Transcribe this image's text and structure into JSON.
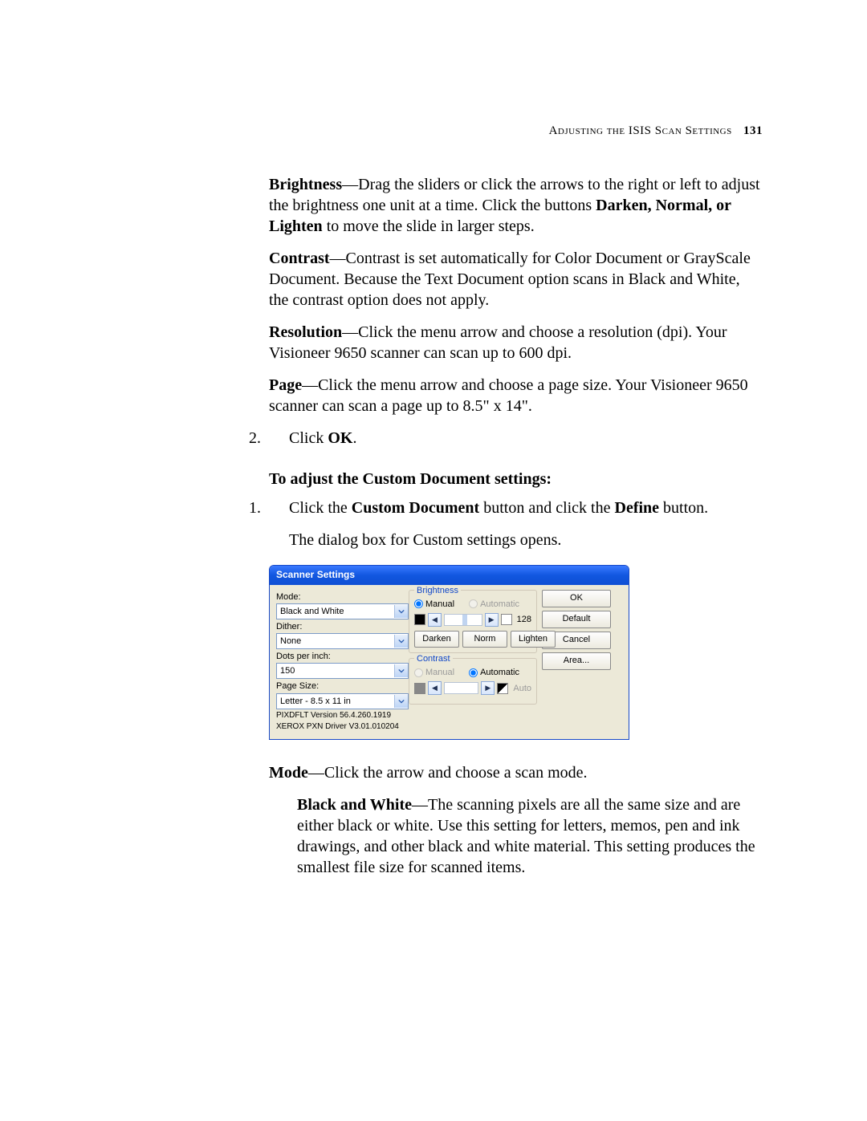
{
  "header": {
    "section": "Adjusting the ISIS Scan Settings",
    "pageno": "131"
  },
  "p_brightness": {
    "label": "Brightness",
    "text": "—Drag the sliders or click the arrows to the right or left to adjust the brightness one unit at a time. Click the buttons ",
    "bold_list": "Darken, Normal, or Lighten",
    "tail": " to move the slide in larger steps."
  },
  "p_contrast": {
    "label": "Contrast",
    "text": "—Contrast is set automatically for Color Document or GrayScale Document. Because the Text Document option scans in Black and White, the contrast option does not apply."
  },
  "p_resolution": {
    "label": "Resolution",
    "text": "—Click the menu arrow and choose a resolution (dpi). Your Visioneer 9650 scanner can scan up to 600 dpi."
  },
  "p_page": {
    "label": "Page",
    "text": "—Click the menu arrow and choose a page size. Your Visioneer 9650 scanner can scan a page up to 8.5\" x 14\"."
  },
  "step2": {
    "num": "2.",
    "pre": "Click ",
    "bold": "OK",
    "post": "."
  },
  "heading2": "To adjust the Custom Document settings:",
  "step_cd": {
    "num": "1.",
    "pre": "Click the ",
    "b1": "Custom Document",
    "mid": " button and click the ",
    "b2": "Define",
    "post": " button."
  },
  "step_cd_line2": "The dialog box for Custom settings opens.",
  "dialog": {
    "title": "Scanner Settings",
    "mode": {
      "label": "Mode:",
      "value": "Black and White"
    },
    "dither": {
      "label": "Dither:",
      "value": "None"
    },
    "dpi": {
      "label": "Dots per inch:",
      "value": "150"
    },
    "pagesize": {
      "label": "Page Size:",
      "value": "Letter - 8.5 x 11 in"
    },
    "version1": "PIXDFLT Version 56.4.260.1919",
    "version2": "XEROX PXN Driver V3.01.010204",
    "brightness": {
      "legend": "Brightness",
      "manual": "Manual",
      "auto": "Automatic",
      "value": "128",
      "darken": "Darken",
      "norm": "Norm",
      "lighten": "Lighten"
    },
    "contrast": {
      "legend": "Contrast",
      "manual": "Manual",
      "auto": "Automatic",
      "autoLabel": "Auto"
    },
    "buttons": {
      "ok": "OK",
      "def": "Default",
      "cancel": "Cancel",
      "area": "Area..."
    }
  },
  "p_mode": {
    "label": "Mode",
    "text": "—Click the arrow and choose a scan mode."
  },
  "p_bw": {
    "label": "Black and White",
    "text": "—The scanning pixels are all the same size and are either black or white. Use this setting for letters, memos, pen and ink drawings, and other black and white material. This setting produces the smallest file size for scanned items."
  }
}
